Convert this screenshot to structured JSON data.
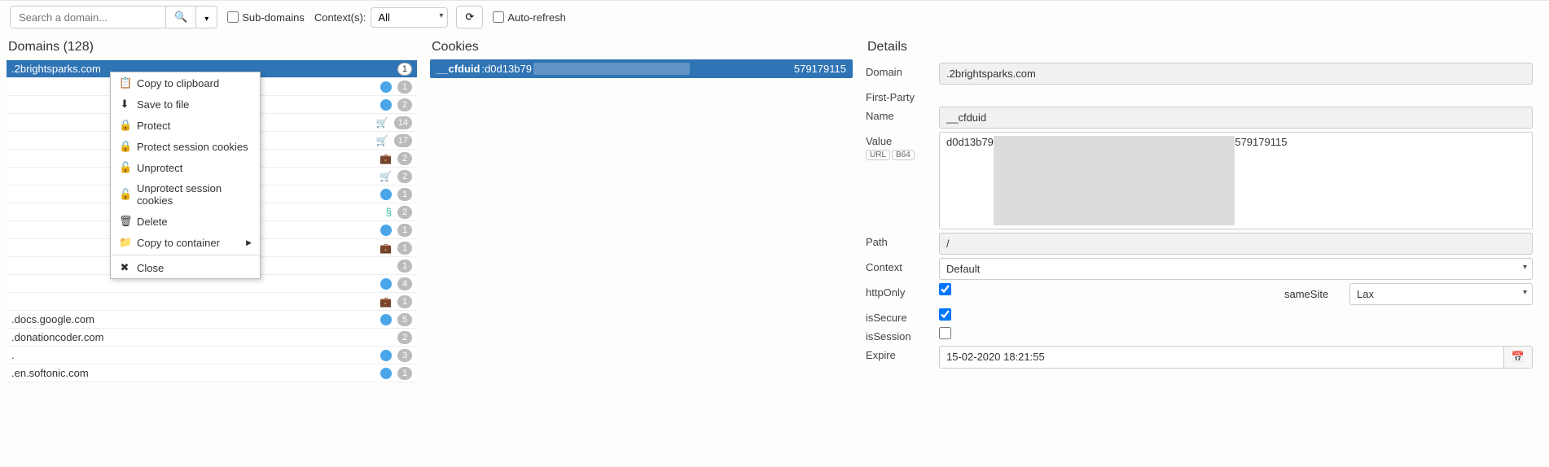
{
  "toolbar": {
    "search_placeholder": "Search a domain...",
    "subdomains_label": "Sub-domains",
    "contexts_label": "Context(s):",
    "contexts_value": "All",
    "autorefresh_label": "Auto-refresh"
  },
  "domains": {
    "header": "Domains (128)",
    "rows": [
      {
        "name": ".2brightsparks.com",
        "selected": true,
        "icons": [],
        "count": "1",
        "badge_white": true
      },
      {
        "name": " ",
        "icons": [
          "dot"
        ],
        "count": "1"
      },
      {
        "name": " ",
        "icons": [
          "dot"
        ],
        "count": "2"
      },
      {
        "name": " ",
        "icons": [
          "cart"
        ],
        "count": "14"
      },
      {
        "name": " ",
        "icons": [
          "cart"
        ],
        "count": "17"
      },
      {
        "name": " ",
        "icons": [
          "brief"
        ],
        "count": "2"
      },
      {
        "name": " ",
        "icons": [
          "cart"
        ],
        "count": "2"
      },
      {
        "name": " ",
        "icons": [
          "dot"
        ],
        "count": "1"
      },
      {
        "name": " ",
        "icons": [
          "swirl"
        ],
        "count": "2"
      },
      {
        "name": " ",
        "icons": [
          "dot"
        ],
        "count": "1"
      },
      {
        "name": " ",
        "icons": [
          "brief"
        ],
        "count": "1"
      },
      {
        "name": " ",
        "icons": [],
        "count": "1"
      },
      {
        "name": " ",
        "icons": [
          "dot"
        ],
        "count": "4"
      },
      {
        "name": " ",
        "icons": [
          "brief"
        ],
        "count": "1"
      },
      {
        "name": ".docs.google.com",
        "icons": [
          "dot"
        ],
        "count": "5"
      },
      {
        "name": ".donationcoder.com",
        "icons": [],
        "count": "2"
      },
      {
        "name": ".",
        "icons": [
          "dot"
        ],
        "count": "3"
      },
      {
        "name": ".en.softonic.com",
        "icons": [
          "dot"
        ],
        "count": "1"
      }
    ]
  },
  "context_menu": {
    "items": [
      {
        "icon": "📋",
        "label": "Copy to clipboard"
      },
      {
        "icon": "⬇",
        "label": "Save to file"
      },
      {
        "icon": "🔒",
        "label": "Protect"
      },
      {
        "icon": "🔒",
        "label": "Protect session cookies"
      },
      {
        "icon": "🔓",
        "label": "Unprotect"
      },
      {
        "icon": "🔓",
        "label": "Unprotect session cookies"
      },
      {
        "icon": "🗑",
        "label": "Delete"
      },
      {
        "icon": "📁",
        "label": "Copy to container",
        "submenu": true
      },
      {
        "sep": true
      },
      {
        "icon": "✖",
        "label": "Close"
      }
    ]
  },
  "cookies": {
    "header": "Cookies",
    "row": {
      "name": "__cfduid",
      "val_prefix": ":d0d13b79",
      "val_hidden": "xxxxxxxxxxxxxxxxxxxxxxxxxxxxx",
      "tail": "579179115"
    }
  },
  "details": {
    "header": "Details",
    "domain_label": "Domain",
    "domain_value": ".2brightsparks.com",
    "firstparty_label": "First-Party",
    "name_label": "Name",
    "name_value": "__cfduid",
    "value_label": "Value",
    "url_badge": "URL",
    "b64_badge": "B64",
    "value_prefix": "d0d13b79",
    "value_tail": "579179115",
    "path_label": "Path",
    "path_value": "/",
    "context_label": "Context",
    "context_value": "Default",
    "httponly_label": "httpOnly",
    "samesite_label": "sameSite",
    "samesite_value": "Lax",
    "issecure_label": "isSecure",
    "issession_label": "isSession",
    "expire_label": "Expire",
    "expire_value": "15-02-2020 18:21:55"
  }
}
